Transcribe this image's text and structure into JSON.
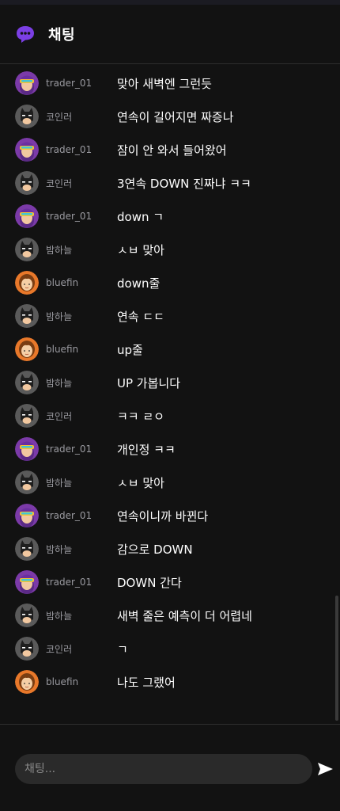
{
  "header": {
    "title": "채팅",
    "icon": "chat-bubble-icon",
    "accent": "#7b3fe4"
  },
  "avatars": {
    "purple": {
      "bg": "#7b3aa8",
      "icon": "yellow-visor-avatar"
    },
    "gray": {
      "bg": "#5a5a5a",
      "icon": "masked-hero-avatar"
    },
    "orange": {
      "bg": "#e8782a",
      "icon": "girl-avatar"
    }
  },
  "messages": [
    {
      "user": "trader_01",
      "avatar": "purple",
      "text": "맞아 새벽엔 그런듯"
    },
    {
      "user": "코인러",
      "avatar": "gray",
      "text": "연속이 길어지면 짜증나"
    },
    {
      "user": "trader_01",
      "avatar": "purple",
      "text": "잠이 안 와서 들어왔어"
    },
    {
      "user": "코인러",
      "avatar": "gray",
      "text": "3연속 DOWN 진짜냐 ㅋㅋ"
    },
    {
      "user": "trader_01",
      "avatar": "purple",
      "text": "down ㄱ"
    },
    {
      "user": "밤하늘",
      "avatar": "gray",
      "text": "ㅅㅂ 맞아"
    },
    {
      "user": "bluefin",
      "avatar": "orange",
      "text": "down줄"
    },
    {
      "user": "밤하늘",
      "avatar": "gray",
      "text": "연속 ㄷㄷ"
    },
    {
      "user": "bluefin",
      "avatar": "orange",
      "text": "up줄"
    },
    {
      "user": "밤하늘",
      "avatar": "gray",
      "text": "UP 가봅니다"
    },
    {
      "user": "코인러",
      "avatar": "gray",
      "text": "ㅋㅋ ㄹㅇ"
    },
    {
      "user": "trader_01",
      "avatar": "purple",
      "text": "개인정 ㅋㅋ"
    },
    {
      "user": "밤하늘",
      "avatar": "gray",
      "text": "ㅅㅂ 맞아"
    },
    {
      "user": "trader_01",
      "avatar": "purple",
      "text": "연속이니까 바뀐다"
    },
    {
      "user": "밤하늘",
      "avatar": "gray",
      "text": "감으로 DOWN"
    },
    {
      "user": "trader_01",
      "avatar": "purple",
      "text": "DOWN 간다"
    },
    {
      "user": "밤하늘",
      "avatar": "gray",
      "text": "새벽 줄은 예측이 더 어렵네"
    },
    {
      "user": "코인러",
      "avatar": "gray",
      "text": "ㄱ"
    },
    {
      "user": "bluefin",
      "avatar": "orange",
      "text": "나도 그랬어"
    }
  ],
  "composer": {
    "placeholder": "채팅...",
    "value": "",
    "send_icon": "send-icon"
  }
}
